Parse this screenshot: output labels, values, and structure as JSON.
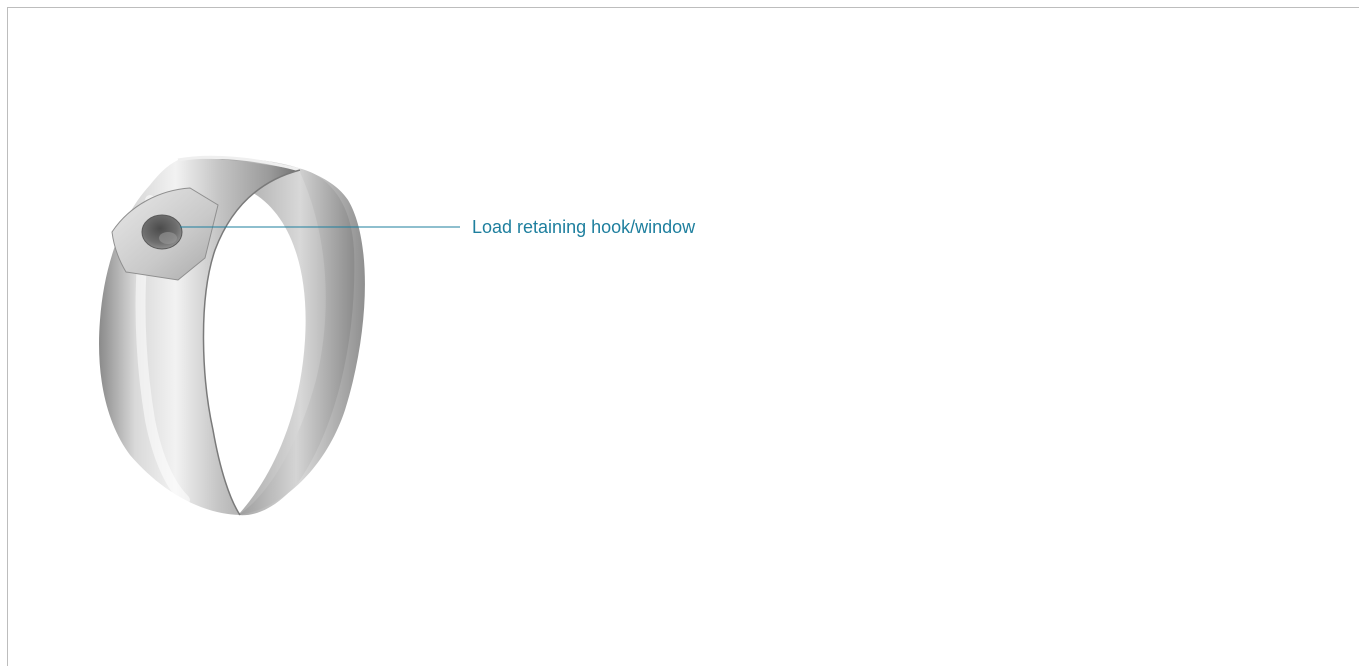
{
  "figure": {
    "subject": "clamp-ring-icon",
    "callout": {
      "label": "Load retaining hook/window"
    }
  },
  "colors": {
    "accent": "#1e7f9e",
    "frame_border": "#bdbdbd",
    "background": "#ffffff",
    "metal_light": "#e6e6e6",
    "metal_mid": "#b9b9b9",
    "metal_dark": "#7d7d7d"
  }
}
